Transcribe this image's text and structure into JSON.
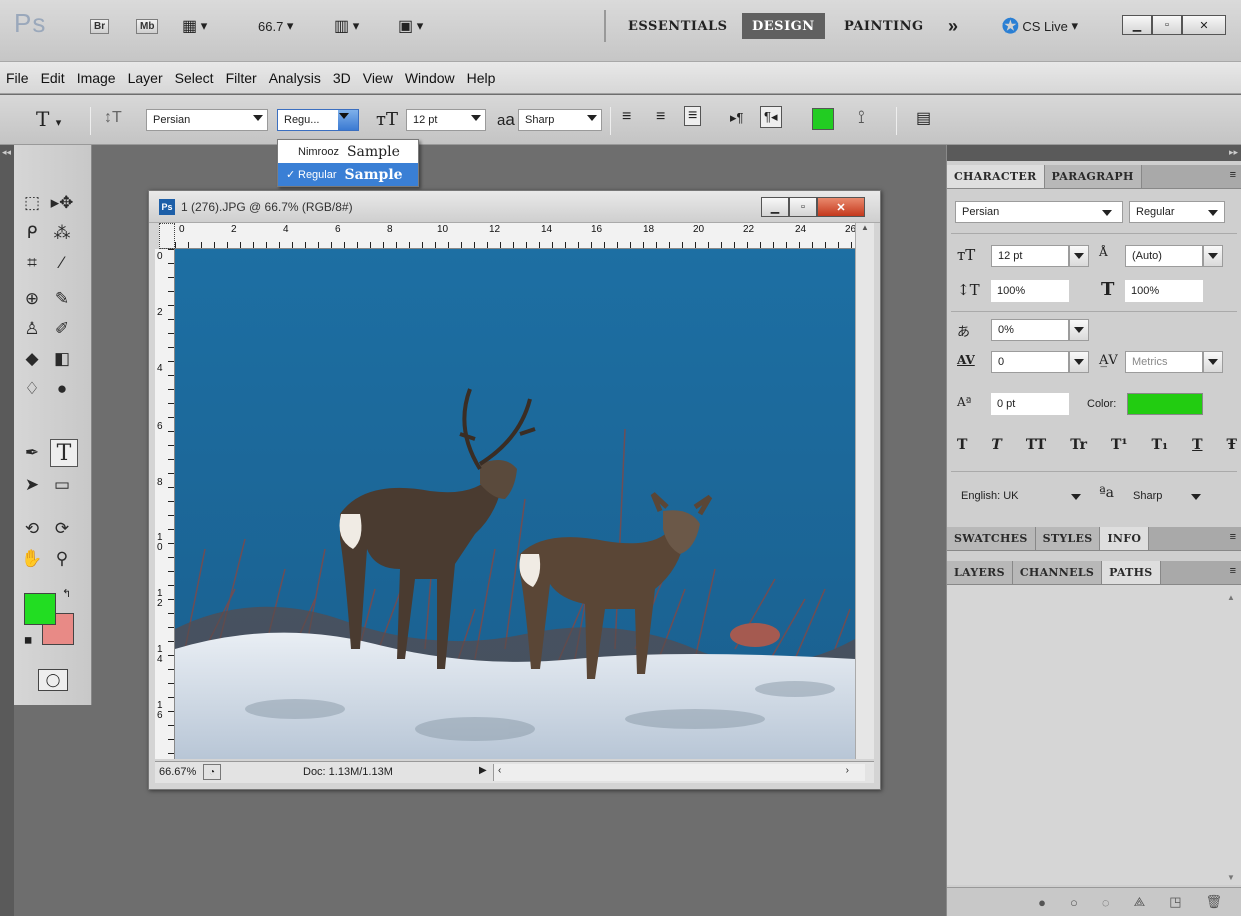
{
  "appbar": {
    "zoom": "66.7",
    "bridge": "Br",
    "minibridge": "Mb",
    "workspaces": [
      "ESSENTIALS",
      "DESIGN",
      "PAINTING"
    ],
    "more": "»",
    "cslive": "CS Live"
  },
  "menu": [
    "File",
    "Edit",
    "Image",
    "Layer",
    "Select",
    "Filter",
    "Analysis",
    "3D",
    "View",
    "Window",
    "Help"
  ],
  "options": {
    "font_family": "Persian",
    "font_style": "Regu...",
    "font_size": "12 pt",
    "aa_label": "a",
    "aa_value": "Sharp",
    "text_color": "#22cc22"
  },
  "font_dropdown": [
    {
      "name": "Nimrooz",
      "sample": "Sample",
      "selected": false
    },
    {
      "name": "Regular",
      "sample": "Sample",
      "selected": true
    }
  ],
  "document": {
    "title": "1 (276).JPG @ 66.7% (RGB/8#)",
    "zoom": "66.67%",
    "doc_info": "Doc: 1.13M/1.13M",
    "ruler_h": [
      "0",
      "2",
      "4",
      "6",
      "8",
      "10",
      "12",
      "14",
      "16",
      "18",
      "20",
      "22",
      "24",
      "26"
    ],
    "ruler_v": [
      "0",
      "2",
      "4",
      "6",
      "8",
      "1\n0",
      "1\n2",
      "1\n4",
      "1\n6"
    ]
  },
  "colors": {
    "foreground": "#22dd22",
    "background": "#e88a86"
  },
  "character_panel": {
    "tabs": [
      "CHARACTER",
      "PARAGRAPH"
    ],
    "font_family": "Persian",
    "font_style": "Regular",
    "size": "12 pt",
    "leading": "(Auto)",
    "vscale": "100%",
    "hscale": "100%",
    "tsume": "0%",
    "tracking": "0",
    "kerning": "Metrics",
    "baseline": "0 pt",
    "color_label": "Color:",
    "color": "#22cc11",
    "style_buttons": [
      "T",
      "T",
      "TT",
      "Tr",
      "T¹",
      "T₁",
      "T",
      "Ŧ"
    ],
    "language": "English: UK",
    "aa_value": "Sharp"
  },
  "swatch_tabs": [
    "SWATCHES",
    "STYLES",
    "INFO"
  ],
  "layers_tabs": [
    "LAYERS",
    "CHANNELS",
    "PATHS"
  ]
}
